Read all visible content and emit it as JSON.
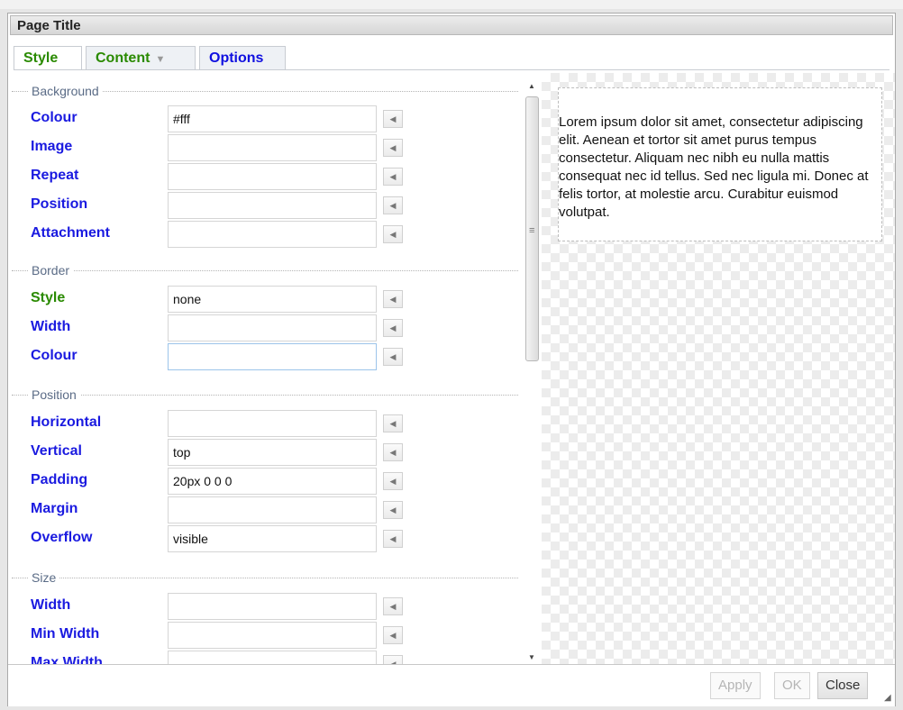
{
  "dialog": {
    "title": "Page Title"
  },
  "tabs": [
    {
      "label": "Style"
    },
    {
      "label": "Content",
      "arrow": "▼"
    },
    {
      "label": "Options"
    }
  ],
  "sections": {
    "background": {
      "heading": "Background",
      "rows": [
        {
          "label": "Colour",
          "value": "#fff"
        },
        {
          "label": "Image",
          "value": ""
        },
        {
          "label": "Repeat",
          "value": ""
        },
        {
          "label": "Position",
          "value": ""
        },
        {
          "label": "Attachment",
          "value": ""
        }
      ]
    },
    "border": {
      "heading": "Border",
      "rows": [
        {
          "label": "Style",
          "value": "none"
        },
        {
          "label": "Width",
          "value": ""
        },
        {
          "label": "Colour",
          "value": ""
        }
      ]
    },
    "position": {
      "heading": "Position",
      "rows": [
        {
          "label": "Horizontal",
          "value": ""
        },
        {
          "label": "Vertical",
          "value": "top"
        },
        {
          "label": "Padding",
          "value": "20px 0 0 0"
        },
        {
          "label": "Margin",
          "value": ""
        },
        {
          "label": "Overflow",
          "value": "visible"
        }
      ]
    },
    "size": {
      "heading": "Size",
      "rows": [
        {
          "label": "Width",
          "value": ""
        },
        {
          "label": "Min Width",
          "value": ""
        },
        {
          "label": "Max Width",
          "value": ""
        }
      ]
    }
  },
  "preview": {
    "text": "Lorem ipsum dolor sit amet, consectetur adipiscing elit. Aenean et tortor sit amet purus tempus consectetur. Aliquam nec nibh eu nulla mattis consequat nec id tellus. Sed nec ligula mi. Donec at felis tortor, at molestie arcu. Curabitur euismod volutpat."
  },
  "footer": {
    "apply": "Apply",
    "ok": "OK",
    "close": "Close"
  },
  "icons": {
    "dropdown": "triangle-left-icon",
    "scroll_up": "triangle-up-icon",
    "scroll_down": "triangle-down-icon",
    "resize": "resize-grip-icon"
  },
  "colors": {
    "label_blue": "#1a1ae0",
    "label_green": "#2a8a00",
    "section_heading": "#5a6b86"
  }
}
